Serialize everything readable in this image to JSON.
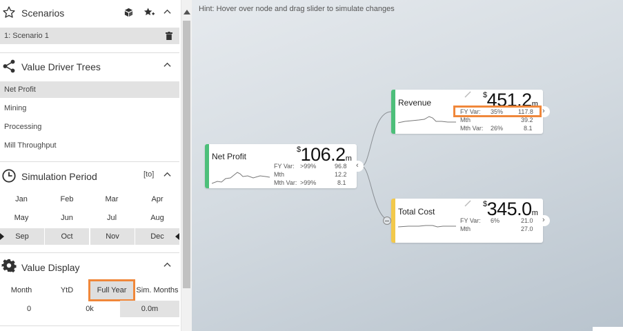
{
  "scenarios": {
    "title": "Scenarios",
    "items": [
      {
        "label": "1: Scenario 1"
      }
    ]
  },
  "value_driver_trees": {
    "title": "Value Driver Trees",
    "items": [
      {
        "label": "Net Profit",
        "active": true
      },
      {
        "label": "Mining"
      },
      {
        "label": "Processing"
      },
      {
        "label": "Mill Throughput"
      }
    ]
  },
  "simulation_period": {
    "title": "Simulation Period",
    "tag": "[to]",
    "months": [
      "Jan",
      "Feb",
      "Mar",
      "Apr",
      "May",
      "Jun",
      "Jul",
      "Aug",
      "Sep",
      "Oct",
      "Nov",
      "Dec"
    ],
    "selected": [
      "Sep",
      "Oct",
      "Nov",
      "Dec"
    ]
  },
  "value_display": {
    "title": "Value Display",
    "options": [
      "Month",
      "YtD",
      "Full Year",
      "Sim. Months"
    ],
    "selected": "Full Year",
    "values": [
      "0",
      "0k",
      "0.0m"
    ]
  },
  "canvas": {
    "hint": "Hint: Hover over node and drag slider to simulate changes"
  },
  "nodes": {
    "net_profit": {
      "name": "Net Profit",
      "currency": "$",
      "value": "106.2",
      "unit": "m",
      "color": "#4dbf7a",
      "rows": [
        {
          "label": "FY Var:",
          "pct": ">99%",
          "val": "96.8"
        },
        {
          "label": "Mth",
          "pct": "",
          "val": "12.2"
        },
        {
          "label": "Mth Var:",
          "pct": ">99%",
          "val": "8.1"
        }
      ]
    },
    "revenue": {
      "name": "Revenue",
      "currency": "$",
      "value": "451.2",
      "unit": "m",
      "color": "#4dbf7a",
      "rows": [
        {
          "label": "FY Var:",
          "pct": "35%",
          "val": "117.8"
        },
        {
          "label": "Mth",
          "pct": "",
          "val": "39.2"
        },
        {
          "label": "Mth Var:",
          "pct": "26%",
          "val": "8.1"
        }
      ]
    },
    "total_cost": {
      "name": "Total Cost",
      "currency": "$",
      "value": "345.0",
      "unit": "m",
      "color": "#f2c94c",
      "rows": [
        {
          "label": "FY Var:",
          "pct": "6%",
          "val": "21.0"
        },
        {
          "label": "Mth",
          "pct": "",
          "val": "27.0"
        }
      ]
    }
  },
  "colors": {
    "highlight": "#f0873a",
    "positive": "#4dbf7a",
    "warning": "#f2c94c"
  },
  "icons": [
    "star-outline-icon",
    "cube-stack-icon",
    "star-add-icon",
    "chevron-up-icon",
    "trash-icon",
    "share-icon",
    "clock-icon",
    "gear-icon",
    "pencil-icon",
    "chevron-right-icon",
    "minus-circle-icon"
  ]
}
